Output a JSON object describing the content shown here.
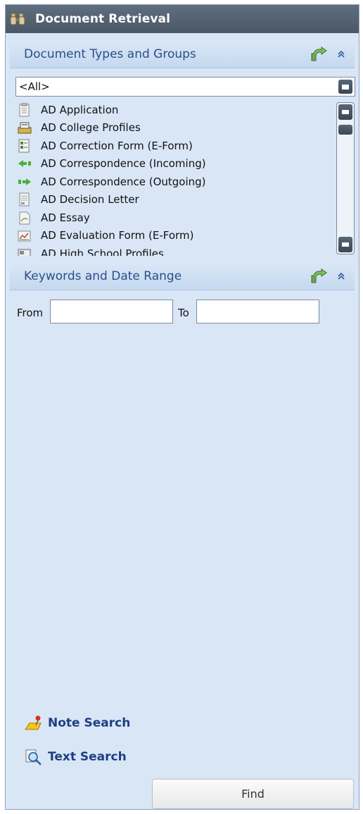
{
  "title": "Document Retrieval",
  "sections": {
    "doc_types": {
      "label": "Document Types and Groups",
      "dropdown_value": "<All>",
      "items": [
        {
          "label": "AD Application",
          "icon": "application-form-icon"
        },
        {
          "label": "AD College Profiles",
          "icon": "college-profiles-icon"
        },
        {
          "label": "AD Correction Form (E-Form)",
          "icon": "eform-icon"
        },
        {
          "label": "AD Correspondence (Incoming)",
          "icon": "incoming-arrow-icon"
        },
        {
          "label": "AD Correspondence (Outgoing)",
          "icon": "outgoing-arrow-icon"
        },
        {
          "label": "AD Decision Letter",
          "icon": "letter-icon"
        },
        {
          "label": "AD Essay",
          "icon": "essay-icon"
        },
        {
          "label": "AD Evaluation Form (E-Form)",
          "icon": "evaluation-chart-icon"
        },
        {
          "label": "AD High School Profiles",
          "icon": "school-profiles-icon"
        }
      ]
    },
    "keywords": {
      "label": "Keywords and Date Range",
      "from_label": "From",
      "to_label": "To",
      "from_value": "",
      "to_value": ""
    }
  },
  "links": {
    "note_search": "Note Search",
    "text_search": "Text Search"
  },
  "find_label": "Find",
  "colors": {
    "panel_bg": "#d8e6f6",
    "titlebar": "#4f5c6b",
    "header_text": "#2a4f8a",
    "link_text": "#1d3f82"
  }
}
